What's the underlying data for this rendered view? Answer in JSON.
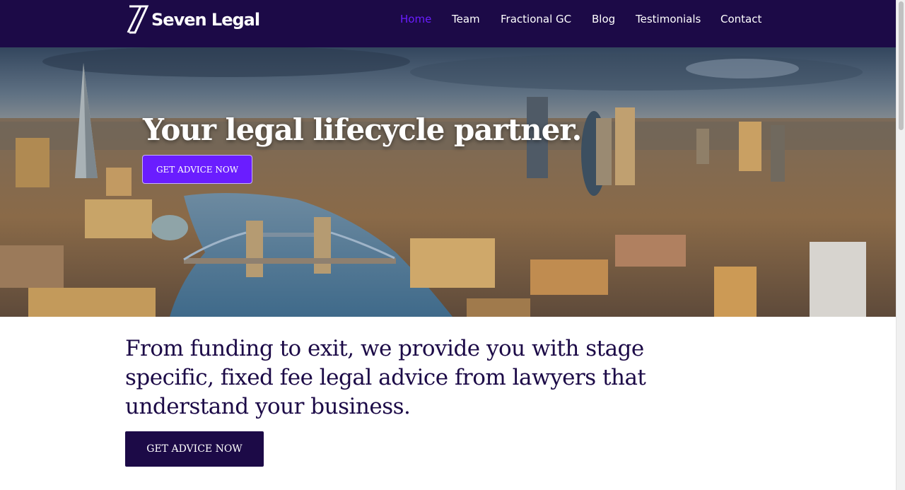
{
  "brand": {
    "name": "Seven Legal"
  },
  "nav": {
    "items": [
      {
        "label": "Home"
      },
      {
        "label": "Team"
      },
      {
        "label": "Fractional GC"
      },
      {
        "label": "Blog"
      },
      {
        "label": "Testimonials"
      },
      {
        "label": "Contact"
      }
    ],
    "active": "Home"
  },
  "hero": {
    "title": "Your legal lifecycle partner.",
    "button_label": "GET ADVICE NOW"
  },
  "main": {
    "lead": "From funding to exit, we provide you with stage specific, fixed fee legal advice from lawyers that understand your business.",
    "button_label": "GET ADVICE NOW"
  },
  "colors": {
    "nav_bg": "#1c0a47",
    "accent": "#6a1dff",
    "text_dark": "#1c0a47"
  }
}
